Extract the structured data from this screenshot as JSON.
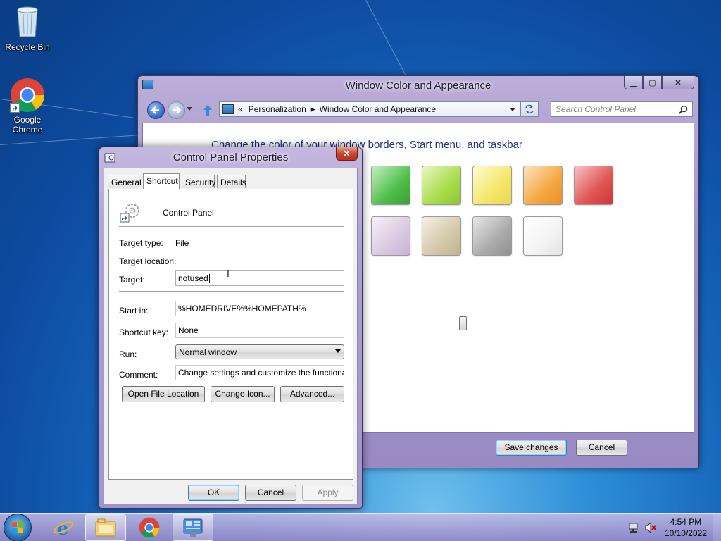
{
  "desktop": {
    "icons": [
      {
        "label": "Recycle Bin"
      },
      {
        "label": "Google Chrome"
      }
    ]
  },
  "main_window": {
    "title": "Window Color and Appearance",
    "breadcrumb": {
      "root": "Personalization",
      "current": "Window Color and Appearance"
    },
    "search_placeholder": "Search Control Panel",
    "heading": "Change the color of your window borders, Start menu, and taskbar",
    "swatches_row1": [
      "#4fbf4a",
      "#a8dc4a",
      "#f4e768",
      "#f4a840",
      "#e05454"
    ],
    "swatches_row2": [
      "#d8c8e0",
      "#d4c8aa",
      "#aaaaaa",
      "#f4f4f4"
    ],
    "save_label": "Save changes",
    "cancel_label": "Cancel"
  },
  "dialog": {
    "title": "Control Panel Properties",
    "close_label": "✕",
    "tabs": [
      {
        "label": "General",
        "active": false
      },
      {
        "label": "Shortcut",
        "active": true
      },
      {
        "label": "Security",
        "active": false
      },
      {
        "label": "Details",
        "active": false
      }
    ],
    "app_name": "Control Panel",
    "target_type_label": "Target type:",
    "target_type_value": "File",
    "target_location_label": "Target location:",
    "target_label": "Target:",
    "target_value": "notused",
    "start_in_label": "Start in:",
    "start_in_value": "%HOMEDRIVE%%HOMEPATH%",
    "shortcut_key_label": "Shortcut key:",
    "shortcut_key_value": "None",
    "run_label": "Run:",
    "run_value": "Normal window",
    "comment_label": "Comment:",
    "comment_value": "Change settings and customize the functionality of",
    "open_file_location": "Open File Location",
    "change_icon": "Change Icon...",
    "advanced": "Advanced...",
    "ok": "OK",
    "cancel": "Cancel",
    "apply": "Apply"
  },
  "taskbar": {
    "time": "4:54 PM",
    "date": "10/10/2022"
  }
}
